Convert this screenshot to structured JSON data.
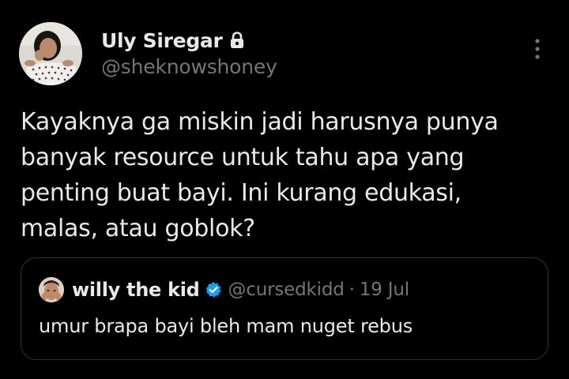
{
  "author": {
    "display_name": "Uly Siregar",
    "handle": "@sheknowshoney",
    "protected_icon": "lock-icon",
    "avatar": "profile-photo"
  },
  "actions": {
    "more_icon": "more-vertical-icon"
  },
  "tweet": {
    "text": "Kayaknya ga miskin jadi harusnya punya\nbanyak resource untuk tahu apa yang\npenting buat bayi. Ini kurang edukasi,\nmalas, atau goblok?"
  },
  "quote": {
    "display_name": "willy the kid",
    "verified_icon": "verified-badge-icon",
    "handle": "@cursedkidd",
    "separator": "·",
    "date": "19 Jul",
    "text": "umur brapa bayi bleh mam nuget rebus"
  },
  "colors": {
    "background": "#000000",
    "primary_text": "#e7e9ea",
    "secondary_text": "#71767b",
    "border": "#2f3336",
    "verified_blue": "#1d9bf0"
  }
}
